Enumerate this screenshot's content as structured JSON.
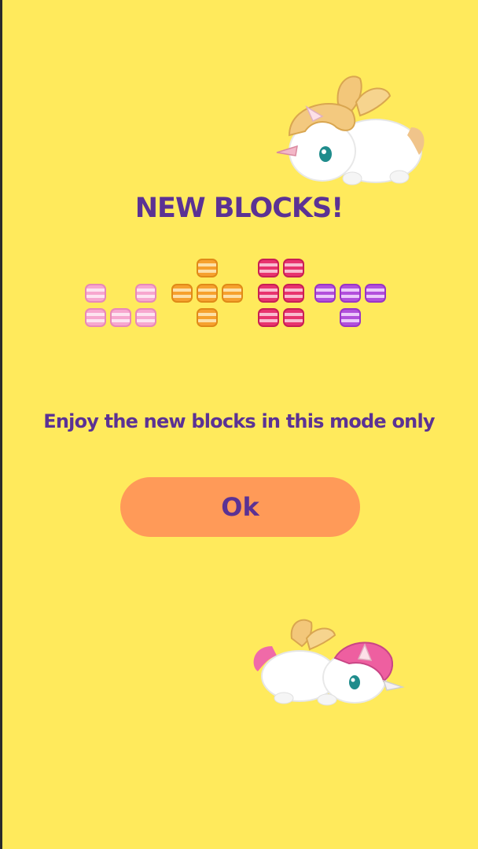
{
  "dialog": {
    "title": "NEW BLOCKS!",
    "subtitle": "Enjoy the new blocks in this mode only",
    "ok_label": "Ok"
  },
  "block_shapes": [
    {
      "name": "l-shape",
      "color": "pink"
    },
    {
      "name": "plus-shape",
      "color": "orange"
    },
    {
      "name": "big-shape",
      "color": "magenta"
    },
    {
      "name": "t-shape",
      "color": "purple"
    }
  ],
  "colors": {
    "background": "#ffea5c",
    "text": "#5b3294",
    "button": "#ff9a58",
    "pink": "#f8a6d0",
    "orange": "#f7a733",
    "magenta": "#e8336e",
    "purple": "#b24fdc"
  }
}
